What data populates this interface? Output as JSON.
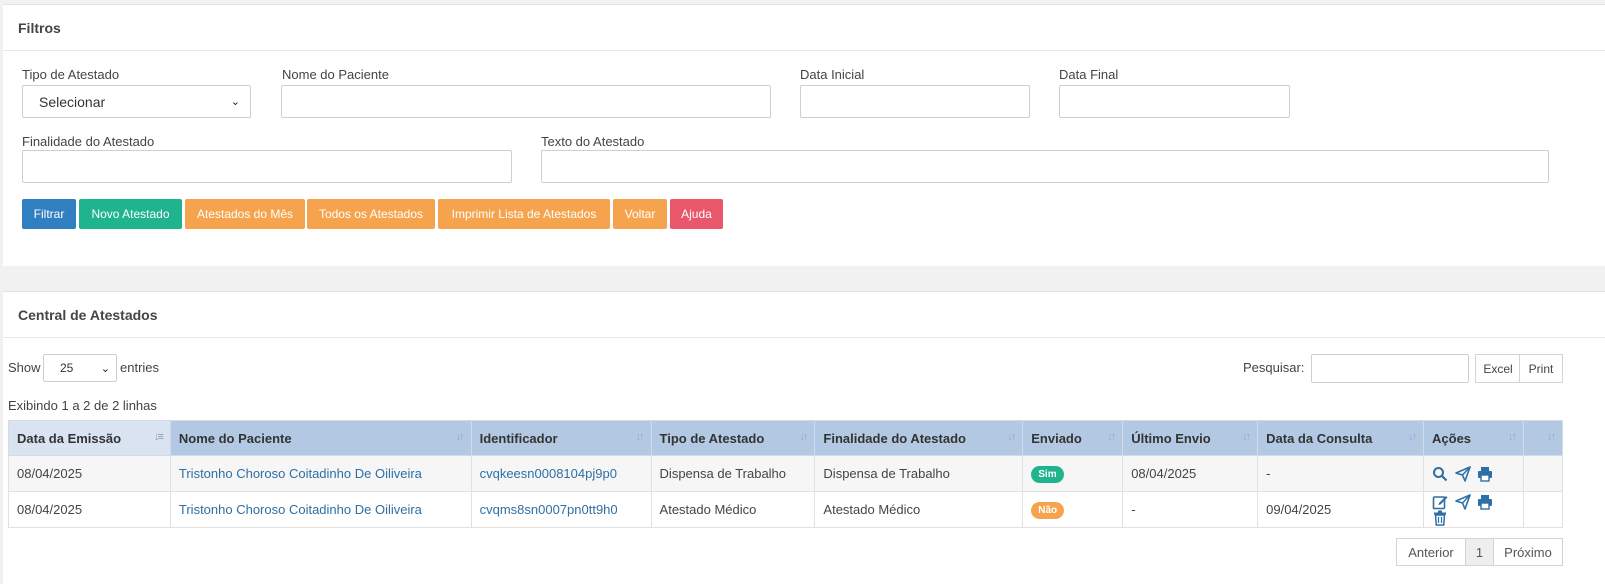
{
  "filters": {
    "title": "Filtros",
    "tipo_label": "Tipo de Atestado",
    "tipo_value": "Selecionar",
    "nome_label": "Nome do Paciente",
    "data_inicial_label": "Data Inicial",
    "data_final_label": "Data Final",
    "finalidade_label": "Finalidade do Atestado",
    "texto_label": "Texto do Atestado",
    "buttons": {
      "filtrar": "Filtrar",
      "novo": "Novo Atestado",
      "mes": "Atestados do Mês",
      "todos": "Todos os Atestados",
      "imprimir": "Imprimir Lista de Atestados",
      "voltar": "Voltar",
      "ajuda": "Ajuda"
    }
  },
  "central": {
    "title": "Central de Atestados",
    "show_label": "Show",
    "entries_value": "25",
    "entries_label": "entries",
    "search_label": "Pesquisar:",
    "excel_label": "Excel",
    "print_label": "Print",
    "info": "Exibindo 1 a 2 de 2 linhas",
    "columns": [
      "Data da Emissão",
      "Nome do Paciente",
      "Identificador",
      "Tipo de Atestado",
      "Finalidade do Atestado",
      "Enviado",
      "Último Envio",
      "Data da Consulta",
      "Ações"
    ],
    "rows": [
      {
        "data_emissao": "08/04/2025",
        "paciente": "Tristonho Choroso Coitadinho De Oiliveira",
        "identificador": "cvqkeesn0008104pj9p0",
        "tipo": "Dispensa de Trabalho",
        "finalidade": "Dispensa de Trabalho",
        "enviado": "Sim",
        "ultimo_envio": "08/04/2025",
        "data_consulta": "-",
        "actions": [
          "search-icon",
          "send-icon",
          "print-icon"
        ]
      },
      {
        "data_emissao": "08/04/2025",
        "paciente": "Tristonho Choroso Coitadinho De Oiliveira",
        "identificador": "cvqms8sn0007pn0tt9h0",
        "tipo": "Atestado Médico",
        "finalidade": "Atestado Médico",
        "enviado": "Não",
        "ultimo_envio": "-",
        "data_consulta": "09/04/2025",
        "actions": [
          "edit-icon",
          "send-icon",
          "print-icon",
          "trash-icon"
        ]
      }
    ],
    "pagination": {
      "prev": "Anterior",
      "page": "1",
      "next": "Próximo"
    }
  },
  "colors": {
    "primary": "#2f7fc1",
    "success": "#1fb48e",
    "warning": "#f5a44d",
    "danger": "#e9576a",
    "header": "#b3c8e3",
    "link": "#2e6fa5",
    "icon": "#2e6fa5"
  }
}
